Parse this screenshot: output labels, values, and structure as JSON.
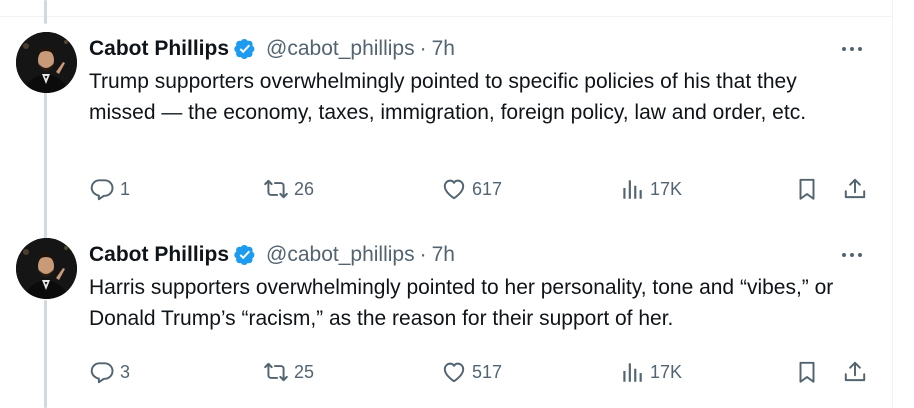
{
  "colors": {
    "text_primary": "#0f1419",
    "text_secondary": "#536471",
    "verified_blue": "#1d9bf0",
    "thread_line": "#cfd9de"
  },
  "tweets": [
    {
      "author": {
        "name": "Cabot Phillips",
        "handle": "@cabot_phillips",
        "verified": true
      },
      "separator": "·",
      "time": "7h",
      "text": "Trump supporters overwhelmingly pointed to specific policies of his that they missed — the economy, taxes, immigration, foreign policy, law and order, etc.",
      "metrics": {
        "replies": "1",
        "retweets": "26",
        "likes": "617",
        "views": "17K"
      }
    },
    {
      "author": {
        "name": "Cabot Phillips",
        "handle": "@cabot_phillips",
        "verified": true
      },
      "separator": "·",
      "time": "7h",
      "text": "Harris supporters overwhelmingly pointed to her personality, tone and “vibes,” or Donald Trump’s “racism,” as the reason for their support of her.",
      "metrics": {
        "replies": "3",
        "retweets": "25",
        "likes": "517",
        "views": "17K"
      }
    }
  ]
}
